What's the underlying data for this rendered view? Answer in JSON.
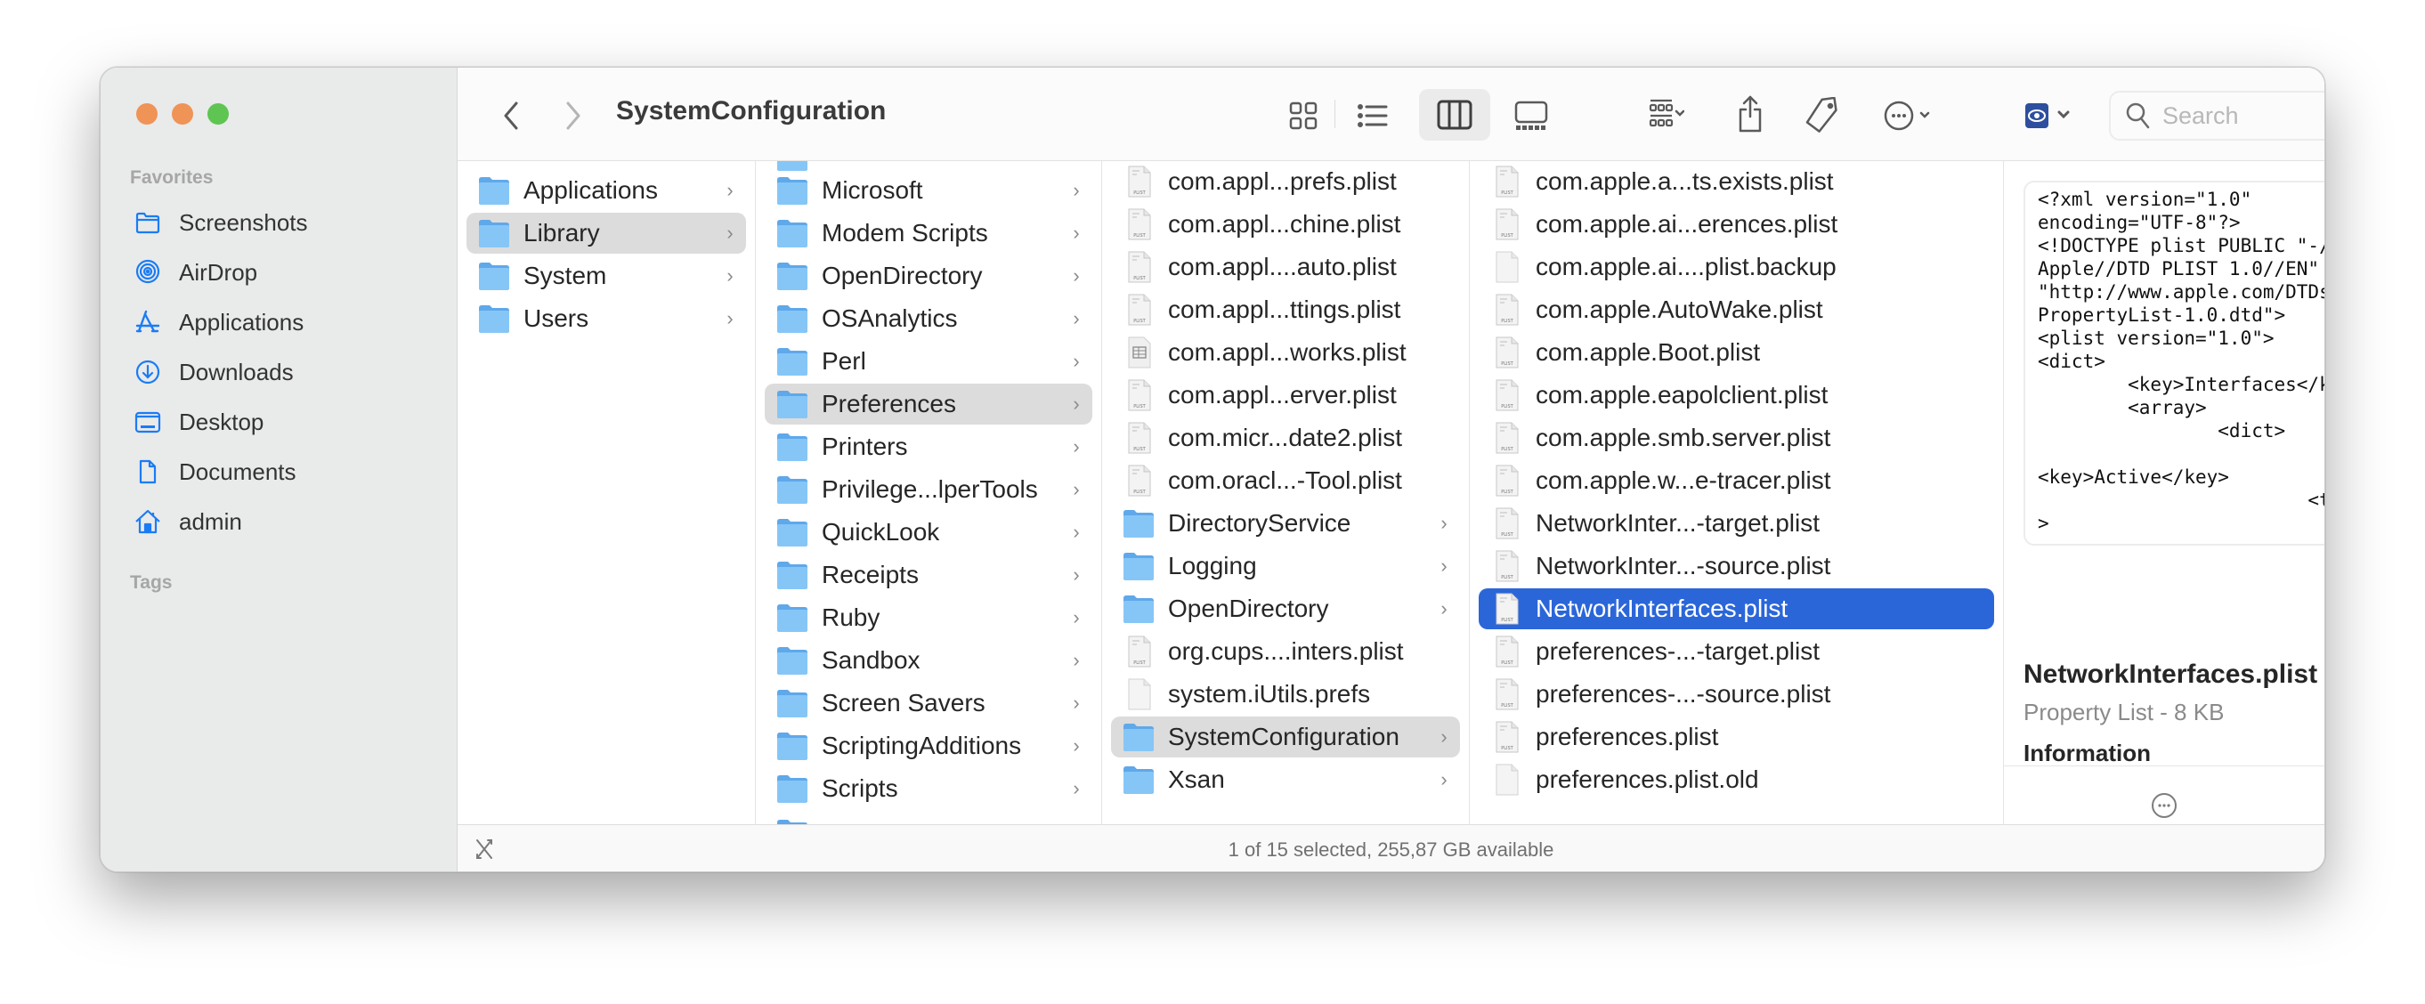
{
  "window": {
    "title": "SystemConfiguration",
    "traffic_lights": {
      "close": "#ef9356",
      "minimize": "#ef9356",
      "maximize": "#5fc552"
    }
  },
  "sidebar": {
    "favorites_label": "Favorites",
    "tags_label": "Tags",
    "items": [
      {
        "label": "Screenshots",
        "icon": "folder-icon"
      },
      {
        "label": "AirDrop",
        "icon": "airdrop-icon"
      },
      {
        "label": "Applications",
        "icon": "applications-icon"
      },
      {
        "label": "Downloads",
        "icon": "downloads-icon"
      },
      {
        "label": "Desktop",
        "icon": "desktop-icon"
      },
      {
        "label": "Documents",
        "icon": "document-icon"
      },
      {
        "label": "admin",
        "icon": "home-icon"
      }
    ]
  },
  "toolbar": {
    "back_icon": "chevron-left-icon",
    "forward_icon": "chevron-right-icon",
    "views": [
      "icon-view",
      "list-view",
      "column-view",
      "gallery-view"
    ],
    "active_view": "column-view",
    "group_icon": "group-by-icon",
    "share_icon": "share-icon",
    "tag_icon": "tag-icon",
    "more_icon": "ellipsis-circle-icon",
    "preview_icon": "eye-icon",
    "search_placeholder": "Search",
    "search_value": ""
  },
  "columns": [
    {
      "items": [
        {
          "name": "Applications",
          "type": "folder",
          "has_children": true
        },
        {
          "name": "Library",
          "type": "folder",
          "has_children": true,
          "state": "path"
        },
        {
          "name": "System",
          "type": "folder",
          "has_children": true
        },
        {
          "name": "Users",
          "type": "folder",
          "has_children": true
        }
      ]
    },
    {
      "items": [
        {
          "name": "Microsoft",
          "type": "folder",
          "has_children": true
        },
        {
          "name": "Modem Scripts",
          "type": "folder",
          "has_children": true
        },
        {
          "name": "OpenDirectory",
          "type": "folder",
          "has_children": true
        },
        {
          "name": "OSAnalytics",
          "type": "folder",
          "has_children": true
        },
        {
          "name": "Perl",
          "type": "folder",
          "has_children": true
        },
        {
          "name": "Preferences",
          "type": "folder",
          "has_children": true,
          "state": "path"
        },
        {
          "name": "Printers",
          "type": "folder",
          "has_children": true
        },
        {
          "name": "Privilege...lperTools",
          "type": "folder",
          "has_children": true
        },
        {
          "name": "QuickLook",
          "type": "folder",
          "has_children": true
        },
        {
          "name": "Receipts",
          "type": "folder",
          "has_children": true
        },
        {
          "name": "Ruby",
          "type": "folder",
          "has_children": true
        },
        {
          "name": "Sandbox",
          "type": "folder",
          "has_children": true
        },
        {
          "name": "Screen Savers",
          "type": "folder",
          "has_children": true
        },
        {
          "name": "ScriptingAdditions",
          "type": "folder",
          "has_children": true
        },
        {
          "name": "Scripts",
          "type": "folder",
          "has_children": true
        }
      ]
    },
    {
      "items": [
        {
          "name": "com.appl...prefs.plist",
          "type": "plist"
        },
        {
          "name": "com.appl...chine.plist",
          "type": "plist"
        },
        {
          "name": "com.appl....auto.plist",
          "type": "plist"
        },
        {
          "name": "com.appl...ttings.plist",
          "type": "plist"
        },
        {
          "name": "com.appl...works.plist",
          "type": "table"
        },
        {
          "name": "com.appl...erver.plist",
          "type": "plist"
        },
        {
          "name": "com.micr...date2.plist",
          "type": "plist"
        },
        {
          "name": "com.oracl...-Tool.plist",
          "type": "plist"
        },
        {
          "name": "DirectoryService",
          "type": "folder",
          "has_children": true
        },
        {
          "name": "Logging",
          "type": "folder",
          "has_children": true
        },
        {
          "name": "OpenDirectory",
          "type": "folder",
          "has_children": true
        },
        {
          "name": "org.cups....inters.plist",
          "type": "plist"
        },
        {
          "name": "system.iUtils.prefs",
          "type": "blank"
        },
        {
          "name": "SystemConfiguration",
          "type": "folder",
          "has_children": true,
          "state": "path"
        },
        {
          "name": "Xsan",
          "type": "folder",
          "has_children": true
        }
      ]
    },
    {
      "items": [
        {
          "name": "com.apple.a...ts.exists.plist",
          "type": "plist"
        },
        {
          "name": "com.apple.ai...erences.plist",
          "type": "plist"
        },
        {
          "name": "com.apple.ai....plist.backup",
          "type": "blank"
        },
        {
          "name": "com.apple.AutoWake.plist",
          "type": "plist"
        },
        {
          "name": "com.apple.Boot.plist",
          "type": "plist"
        },
        {
          "name": "com.apple.eapolclient.plist",
          "type": "plist"
        },
        {
          "name": "com.apple.smb.server.plist",
          "type": "plist"
        },
        {
          "name": "com.apple.w...e-tracer.plist",
          "type": "plist"
        },
        {
          "name": "NetworkInter...-target.plist",
          "type": "plist"
        },
        {
          "name": "NetworkInter...-source.plist",
          "type": "plist"
        },
        {
          "name": "NetworkInterfaces.plist",
          "type": "plist",
          "state": "selected"
        },
        {
          "name": "preferences-...-target.plist",
          "type": "plist"
        },
        {
          "name": "preferences-...-source.plist",
          "type": "plist"
        },
        {
          "name": "preferences.plist",
          "type": "plist"
        },
        {
          "name": "preferences.plist.old",
          "type": "blank"
        }
      ]
    }
  ],
  "preview": {
    "code": "<?xml version=\"1.0\"\nencoding=\"UTF-8\"?>\n<!DOCTYPE plist PUBLIC \"-//\nApple//DTD PLIST 1.0//EN\"\n\"http://www.apple.com/DTDs/\nPropertyList-1.0.dtd\">\n<plist version=\"1.0\">\n<dict>\n        <key>Interfaces</key>\n        <array>\n                <dict>\n\n<key>Active</key>\n                        <true/\n>",
    "file_name": "NetworkInterfaces.plist",
    "kind_size": "Property List - 8 KB",
    "section": "Information",
    "more_label": "More..."
  },
  "status": {
    "text": "1 of 15 selected, 255,87 GB available"
  },
  "colors": {
    "accent": "#2b66d9",
    "sidebar_icon": "#1a7cf5",
    "folder": "#7cc0f4"
  }
}
